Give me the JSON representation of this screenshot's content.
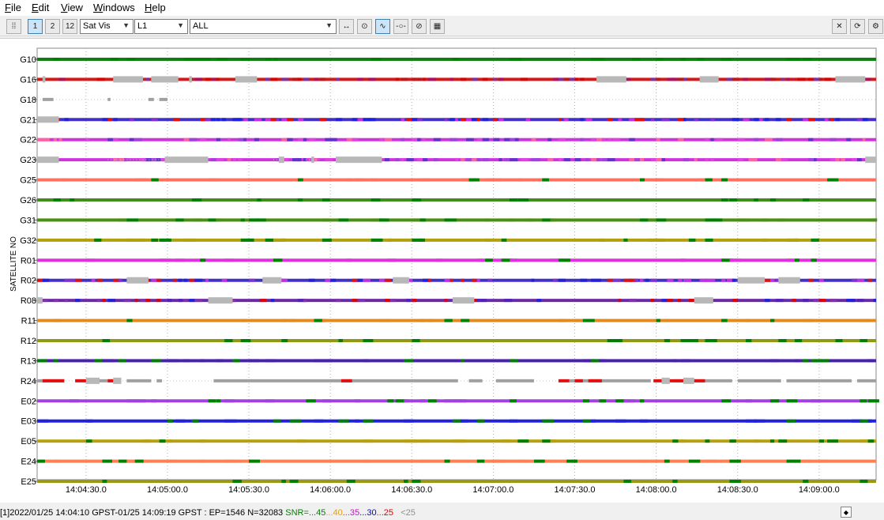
{
  "menu": [
    {
      "label": "File",
      "mnemonic": "F",
      "rest": "ile"
    },
    {
      "label": "Edit",
      "mnemonic": "E",
      "rest": "dit"
    },
    {
      "label": "View",
      "mnemonic": "V",
      "rest": "iew"
    },
    {
      "label": "Windows",
      "mnemonic": "W",
      "rest": "indows"
    },
    {
      "label": "Help",
      "mnemonic": "H",
      "rest": "elp"
    }
  ],
  "toolbar": {
    "plot_type": "Sat Vis",
    "frequency": "L1",
    "satellite_filter": "ALL",
    "btn_1": "1",
    "btn_2": "2",
    "btn_12": "12"
  },
  "chart_data": {
    "type": "timeline",
    "ylabel": "SATELLITE NO",
    "x_ticks": [
      "14:04:30.0",
      "14:05:00.0",
      "14:05:30.0",
      "14:06:00.0",
      "14:06:30.0",
      "14:07:00.0",
      "14:07:30.0",
      "14:08:00.0",
      "14:08:30.0",
      "14:09:00.0"
    ],
    "x_tick_seconds": [
      270,
      300,
      330,
      360,
      390,
      420,
      450,
      480,
      510,
      540
    ],
    "x_range_seconds": [
      252,
      561
    ],
    "grid": true,
    "colors": {
      "snr45": "#008000",
      "snr40": "#e8a000",
      "snr35": "#e000e0",
      "snr30": "#0000e0",
      "snr25": "#e00000",
      "gap": "#b8b8b8"
    },
    "satellites": [
      {
        "id": "G10",
        "color": "#0f7f0f",
        "style": "solid"
      },
      {
        "id": "G16",
        "color": "#e01010",
        "style": "mixed_red",
        "gaps": [
          [
            254,
            255
          ],
          [
            280,
            291
          ],
          [
            294,
            304
          ],
          [
            308,
            309
          ],
          [
            325,
            333
          ],
          [
            458,
            469
          ],
          [
            496,
            503
          ],
          [
            546,
            557
          ]
        ]
      },
      {
        "id": "G18",
        "color": "#a0a0a0",
        "style": "sparse",
        "segments": [
          [
            254,
            258
          ],
          [
            278,
            279
          ],
          [
            293,
            295
          ],
          [
            297,
            300
          ]
        ]
      },
      {
        "id": "G21",
        "color": "#3030d0",
        "style": "mixed_blue",
        "gaps": [
          [
            252,
            260
          ]
        ]
      },
      {
        "id": "G22",
        "color": "#d040e0",
        "style": "mixed_magenta"
      },
      {
        "id": "G23",
        "color": "#d030d0",
        "style": "mixed_magenta",
        "dashed": [
          [
            278,
            298
          ],
          [
            339,
            342
          ],
          [
            351,
            356
          ],
          [
            557,
            561
          ]
        ],
        "gaps": [
          [
            252,
            260
          ],
          [
            299,
            315
          ],
          [
            341,
            343
          ],
          [
            353,
            354
          ],
          [
            362,
            379
          ],
          [
            557,
            561
          ]
        ]
      },
      {
        "id": "G25",
        "color": "#ff7060",
        "style": "solid"
      },
      {
        "id": "G26",
        "color": "#3f8f1f",
        "style": "solid"
      },
      {
        "id": "G31",
        "color": "#4a8f10",
        "style": "solid"
      },
      {
        "id": "G32",
        "color": "#b0a010",
        "style": "solid"
      },
      {
        "id": "R01",
        "color": "#e030e0",
        "style": "solid"
      },
      {
        "id": "R02",
        "color": "#6040c0",
        "style": "mixed_blue",
        "gaps": [
          [
            285,
            293
          ],
          [
            335,
            342
          ],
          [
            383,
            389
          ],
          [
            510,
            520
          ],
          [
            525,
            533
          ]
        ]
      },
      {
        "id": "R08",
        "color": "#7030a0",
        "style": "mixed_purple",
        "gaps": [
          [
            252,
            254
          ],
          [
            315,
            324
          ],
          [
            405,
            413
          ],
          [
            494,
            501
          ]
        ]
      },
      {
        "id": "R11",
        "color": "#e08a20",
        "style": "solid"
      },
      {
        "id": "R12",
        "color": "#8f9a10",
        "style": "solid"
      },
      {
        "id": "R13",
        "color": "#4a20b0",
        "style": "solid"
      },
      {
        "id": "R24",
        "color": "#a0a0a0",
        "style": "r24"
      },
      {
        "id": "E02",
        "color": "#a040e0",
        "style": "solid"
      },
      {
        "id": "E03",
        "color": "#2020e0",
        "style": "solid"
      },
      {
        "id": "E05",
        "color": "#b8a010",
        "style": "solid"
      },
      {
        "id": "E24",
        "color": "#ff8050",
        "style": "solid"
      },
      {
        "id": "E25",
        "color": "#9a9a10",
        "style": "solid"
      }
    ]
  },
  "status": {
    "prefix": "[1]2022/01/25 14:04:10 GPST-01/25 14:09:19 GPST : EP=1546 N=32083",
    "snr_label": "SNR=...",
    "snr45": "45",
    "sep1": "...",
    "snr40": "40",
    "sep2": "...",
    "snr35": "35",
    "sep3": "...",
    "snr30": "30",
    "sep4": "...",
    "snr25": "25",
    "snrlow": "<25"
  }
}
